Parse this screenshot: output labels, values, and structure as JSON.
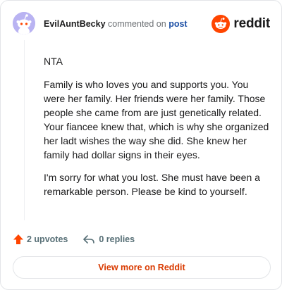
{
  "header": {
    "author": "EvilAuntBecky",
    "action_text": "commented on",
    "post_link": "post",
    "brand": "reddit"
  },
  "comment": {
    "paragraphs": [
      "NTA",
      "Family is who loves you and supports you. You were her family. Her friends were her family. Those people she came from are just genetically related. Your fiancee knew that, which is why she organized her ladt wishes the way she did. She knew her family had dollar signs in their eyes.",
      "I'm sorry for what you lost. She must have been a remarkable person. Please be kind to yourself."
    ]
  },
  "actions": {
    "upvotes": "2 upvotes",
    "replies": "0 replies"
  },
  "footer": {
    "view_more": "View more on Reddit"
  },
  "colors": {
    "brand_orange": "#ff4500",
    "upvote_orange": "#ff4500",
    "link_blue": "#1c4fa5",
    "view_more_text": "#d93a00"
  },
  "icons": {
    "avatar": "snoo-avatar",
    "brand": "reddit-logo-icon",
    "upvote": "upvote-arrow-icon",
    "reply": "reply-arrow-icon"
  }
}
